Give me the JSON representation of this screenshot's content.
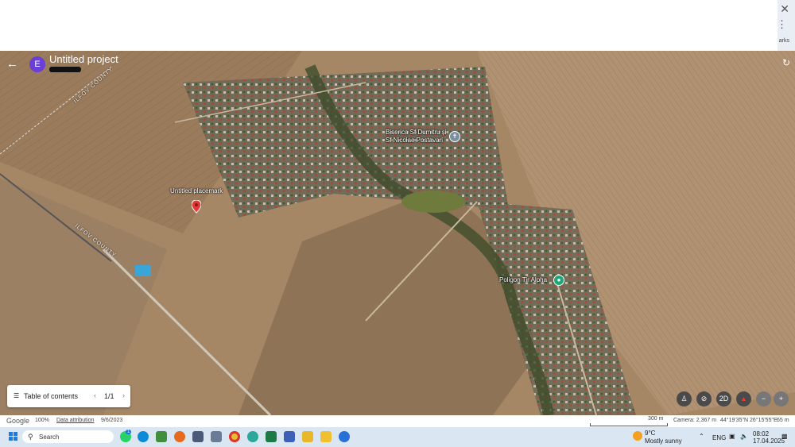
{
  "window": {
    "close_glyph": "✕",
    "menu_glyph": "⋮",
    "bookmarks_fragment": "arks"
  },
  "header": {
    "back_icon": "arrow-left-icon",
    "avatar_letter": "E",
    "project_title": "Untitled project",
    "avatar_color": "#6a3fd6"
  },
  "map": {
    "labels": {
      "placemark": "Untitled placemark",
      "church": "Biserica Sf Dumitru și\nSf Nicolae Postavari",
      "poligon": "Poligon Tir Alpha",
      "ilfov_top": "ILFOV COUNTY",
      "ilfov_bottom": "ILFOV COUNTY"
    },
    "placemark_color": "#e53935",
    "poi_church_color": "#7b8fa3",
    "poi_poligon_color": "#1fa67a"
  },
  "toc": {
    "label": "Table of contents",
    "page": "1/1",
    "prev_glyph": "‹",
    "next_glyph": "›"
  },
  "controls": {
    "view_mode": "2D",
    "zoom_in": "+",
    "zoom_out": "−"
  },
  "status": {
    "brand": "Google",
    "zoom": "100%",
    "attribution": "Data attribution",
    "date": "9/6/2023",
    "scale": "300 m",
    "camera": "Camera: 2,367 m",
    "coords": "44°19'35\"N 26°15'55\"E",
    "elevation": "65 m"
  },
  "taskbar": {
    "search_label": "Search",
    "whatsapp_badge": "1",
    "weather_temp": "9°C",
    "weather_desc": "Mostly sunny",
    "language": "ENG",
    "time": "08:02",
    "date": "17.04.2025"
  }
}
